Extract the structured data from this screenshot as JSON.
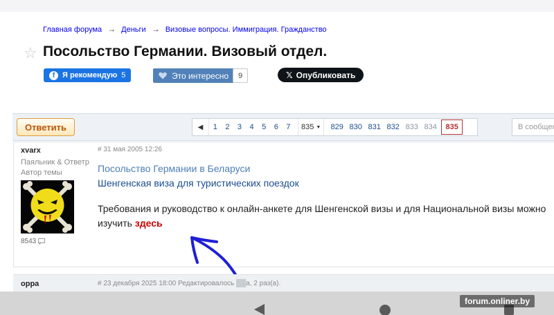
{
  "breadcrumbs": [
    "Главная форума",
    "Деньги",
    "Визовые вопросы. Иммиграция. Гражданство"
  ],
  "breadcrumb_separator": "→",
  "topic": {
    "title": "Посольство Германии. Визовый отдел."
  },
  "social": {
    "fb_label": "Я рекомендую",
    "fb_count": "5",
    "interest_label": "Это интересно",
    "interest_count": "9",
    "tweet_label": "Опубликовать"
  },
  "toolbar": {
    "reply_label": "Ответить",
    "search_placeholder": "В сообщен"
  },
  "pagination": {
    "prev_icon": "◀",
    "first_pages": [
      "1",
      "2",
      "3",
      "4",
      "5",
      "6",
      "7"
    ],
    "selector_value": "835",
    "last_pages": [
      "829",
      "830",
      "831",
      "832",
      "833",
      "834"
    ],
    "current": "835"
  },
  "post": {
    "author": "xvarx",
    "role_line1": "Паяльник & Ответр",
    "role_line2": "Автор темы",
    "posts_count": "8543",
    "meta": "# 31 мая 2005 12:26",
    "link1": "Посольство Германии в Беларуси",
    "link2": "Шенгенская виза для туристических поездок",
    "text_before": "Требования и руководство к онлайн-анкете для Шенгенской визы и для Национальной визы можно изучить ",
    "here_link": "здесь"
  },
  "post2": {
    "author": "oppa",
    "meta": "# 23 декабря 2025 18:00 Редактировалось",
    "meta_tail": "а, 2 раз(а)."
  },
  "watermark": "forum.onliner.by",
  "colors": {
    "accent": "#1a4d8f",
    "current_page": "#b23030",
    "reply_border": "#e09a3a",
    "annotation_arrow": "#1f1fd6"
  }
}
